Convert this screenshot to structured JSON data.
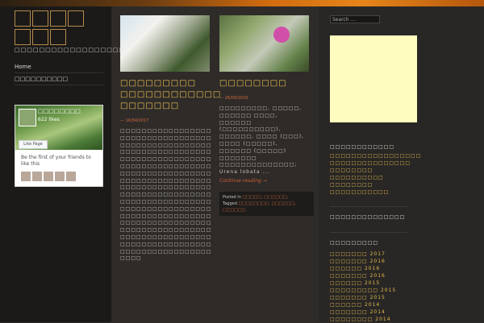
{
  "site": {
    "logo_cells": [
      "□",
      "□",
      "□",
      "□",
      "□",
      "□",
      "□"
    ],
    "name": "□□□□□□□□□□□□□□□□□□□"
  },
  "nav": {
    "items": [
      "Home",
      "□□□□□□□□□□"
    ]
  },
  "facebook": {
    "page_name": "□□□□□□□□",
    "likes": "622 likes",
    "like_button": "Like Page",
    "first_text": "Be the first of your friends to like this"
  },
  "posts": [
    {
      "title": "□□□□□□□□□ □□□□□□□□□□□□ □□□□□□□",
      "date": "— 16/04/2017",
      "body": "□□□□□□□□□□□□□□□□□□□□□□□□□□□□□□□□□□□□□□□□□□□□□□□□□□□□□□□□□□□□□□□□□□□□□□□□□□□□□□□□□□□□□□□□□□□□□□□□□□□□□□□□□□□□□□□□□□□□□□□□□□□□□□□□□□□□□□□□□□□□□□□□□□□□□□□□□□□□□□□□□□□□□□□□□□□□□□□□□□□□□□□□□□□□□□□□□□□□□□□□□□□□□□□□□□□□□□□□□□□□□□□□□□□□□□□□□□□□□□□□□□□□□□□□□□□□□□□□□□□□□□□□□□□□□□□□□□□□□□□□□□□□□□□□□□□□□□□□□□□□□□□□□□□□□□"
    },
    {
      "title": "□□□□□□□□",
      "date": "— 26/09/2016",
      "body": "□□□□□□□□□, □□□□□, □□□□□□ □□□□, □□□□□□ (□□□□□□□□□□), □□□□□□, □□□□ (□□□), □□□□ (□□□□□), □□□□□□ (□□□□□) □□□□□□□ □□□□□□□□□□□□□□; Urena lobata ...",
      "continue": "Continue reading →",
      "posted_in_label": "Posted in",
      "posted_in": "□□□□□, □□□□□□,",
      "tagged_label": "Tagged",
      "tagged": "□□□□□□□□, □□□□□□, □□□□□□."
    }
  ],
  "sidebar": {
    "search_placeholder": "Search ...",
    "widget1_title": "□□□□□□□□□□□□",
    "widget1_items": [
      "□□□□□□□□□□□□□□□□□",
      "□□□□□□□□□□□□□□□",
      "□□□□□□□□",
      "□□□□□□□□□□",
      "□□□□□□□□",
      "□□□□□□□□□□□"
    ],
    "widget2_title": "□□□□□□□□□□□□□□",
    "archives_title": "□□□□□□□□□",
    "archives": [
      {
        "m": "□□□□□□□",
        "y": "2017"
      },
      {
        "m": "□□□□□□□",
        "y": "2016"
      },
      {
        "m": "□□□□□□",
        "y": "2016"
      },
      {
        "m": "□□□□□□□",
        "y": "2016"
      },
      {
        "m": "□□□□□□",
        "y": "2015"
      },
      {
        "m": "□□□□□□□□□",
        "y": "2015"
      },
      {
        "m": "□□□□□□□",
        "y": "2015"
      },
      {
        "m": "□□□□□□",
        "y": "2014"
      },
      {
        "m": "□□□□□□□",
        "y": "2014"
      },
      {
        "m": "□□□□□□□□",
        "y": "2014"
      }
    ]
  }
}
